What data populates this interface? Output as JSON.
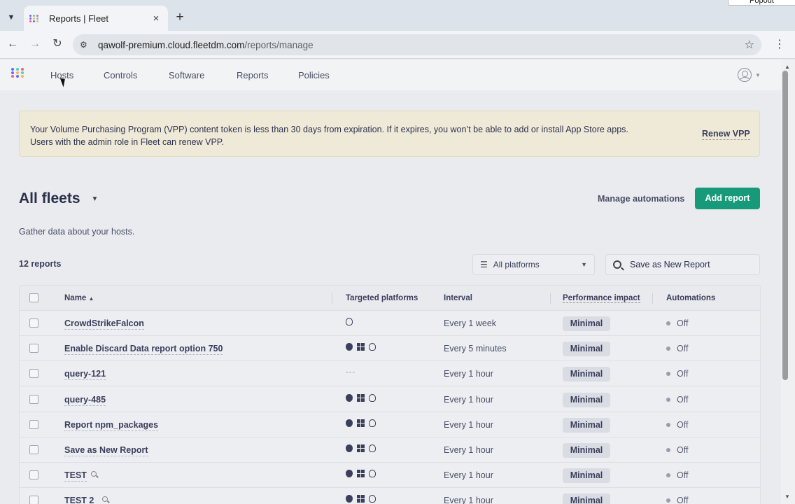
{
  "browser": {
    "tab_title": "Reports | Fleet",
    "tab_close": "×",
    "new_tab": "+",
    "popout_label": "Popout",
    "url_host": "qawolf-premium.cloud.fleetdm.com",
    "url_path": "/reports/manage"
  },
  "nav": {
    "items": [
      "Hosts",
      "Controls",
      "Software",
      "Reports",
      "Policies"
    ]
  },
  "banner": {
    "text_line1": "Your Volume Purchasing Program (VPP) content token is less than 30 days from expiration. If it expires, you won’t be able to add or install App Store apps.",
    "text_line2": "Users with the admin role in Fleet can renew VPP.",
    "action": "Renew VPP"
  },
  "header": {
    "title": "All fleets",
    "manage_automations": "Manage automations",
    "add_report": "Add report",
    "subtitle": "Gather data about your hosts."
  },
  "filters": {
    "count": "12 reports",
    "platform": "All platforms",
    "search_value": "Save as New Report"
  },
  "table": {
    "columns": [
      "Name",
      "Targeted platforms",
      "Interval",
      "Performance impact",
      "Automations"
    ],
    "rows": [
      {
        "name": "CrowdStrikeFalcon",
        "platforms": [
          "linux"
        ],
        "interval": "Every 1 week",
        "impact": "Minimal",
        "automations": "Off",
        "icon": false
      },
      {
        "name": "Enable Discard Data report option 750",
        "platforms": [
          "apple",
          "windows",
          "linux"
        ],
        "interval": "Every 5 minutes",
        "impact": "Minimal",
        "automations": "Off",
        "icon": false
      },
      {
        "name": "query-121",
        "platforms": [],
        "platforms_empty": "---",
        "interval": "Every 1 hour",
        "impact": "Minimal",
        "automations": "Off",
        "icon": false
      },
      {
        "name": "query-485",
        "platforms": [
          "apple",
          "windows",
          "linux"
        ],
        "interval": "Every 1 hour",
        "impact": "Minimal",
        "automations": "Off",
        "icon": false
      },
      {
        "name": "Report npm_packages",
        "platforms": [
          "apple",
          "windows",
          "linux"
        ],
        "interval": "Every 1 hour",
        "impact": "Minimal",
        "automations": "Off",
        "icon": false
      },
      {
        "name": "Save as New Report",
        "platforms": [
          "apple",
          "windows",
          "linux"
        ],
        "interval": "Every 1 hour",
        "impact": "Minimal",
        "automations": "Off",
        "icon": false
      },
      {
        "name": "TEST",
        "platforms": [
          "apple",
          "windows",
          "linux"
        ],
        "interval": "Every 1 hour",
        "impact": "Minimal",
        "automations": "Off",
        "icon": true
      },
      {
        "name": "TEST 2",
        "platforms": [
          "apple",
          "windows",
          "linux"
        ],
        "interval": "Every 1 hour",
        "impact": "Minimal",
        "automations": "Off",
        "icon": true
      }
    ]
  },
  "colors": {
    "accent": "#179a7a",
    "logo": [
      "#6a67fe",
      "#4fd0c4",
      "#ff5c83",
      "#6a67fe",
      "#ffb44d",
      "#4fd0c4",
      "#ff5c83",
      "#6a67fe",
      "#ffb44d"
    ]
  },
  "icons": [
    "chevron-down-icon",
    "close-icon",
    "plus-icon",
    "back-arrow-icon",
    "forward-arrow-icon",
    "reload-icon",
    "site-settings-icon",
    "star-icon",
    "kebab-icon",
    "user-icon",
    "filter-icon",
    "search-icon",
    "sort-up-icon",
    "apple-icon",
    "windows-icon",
    "linux-icon",
    "magnifier-icon"
  ]
}
